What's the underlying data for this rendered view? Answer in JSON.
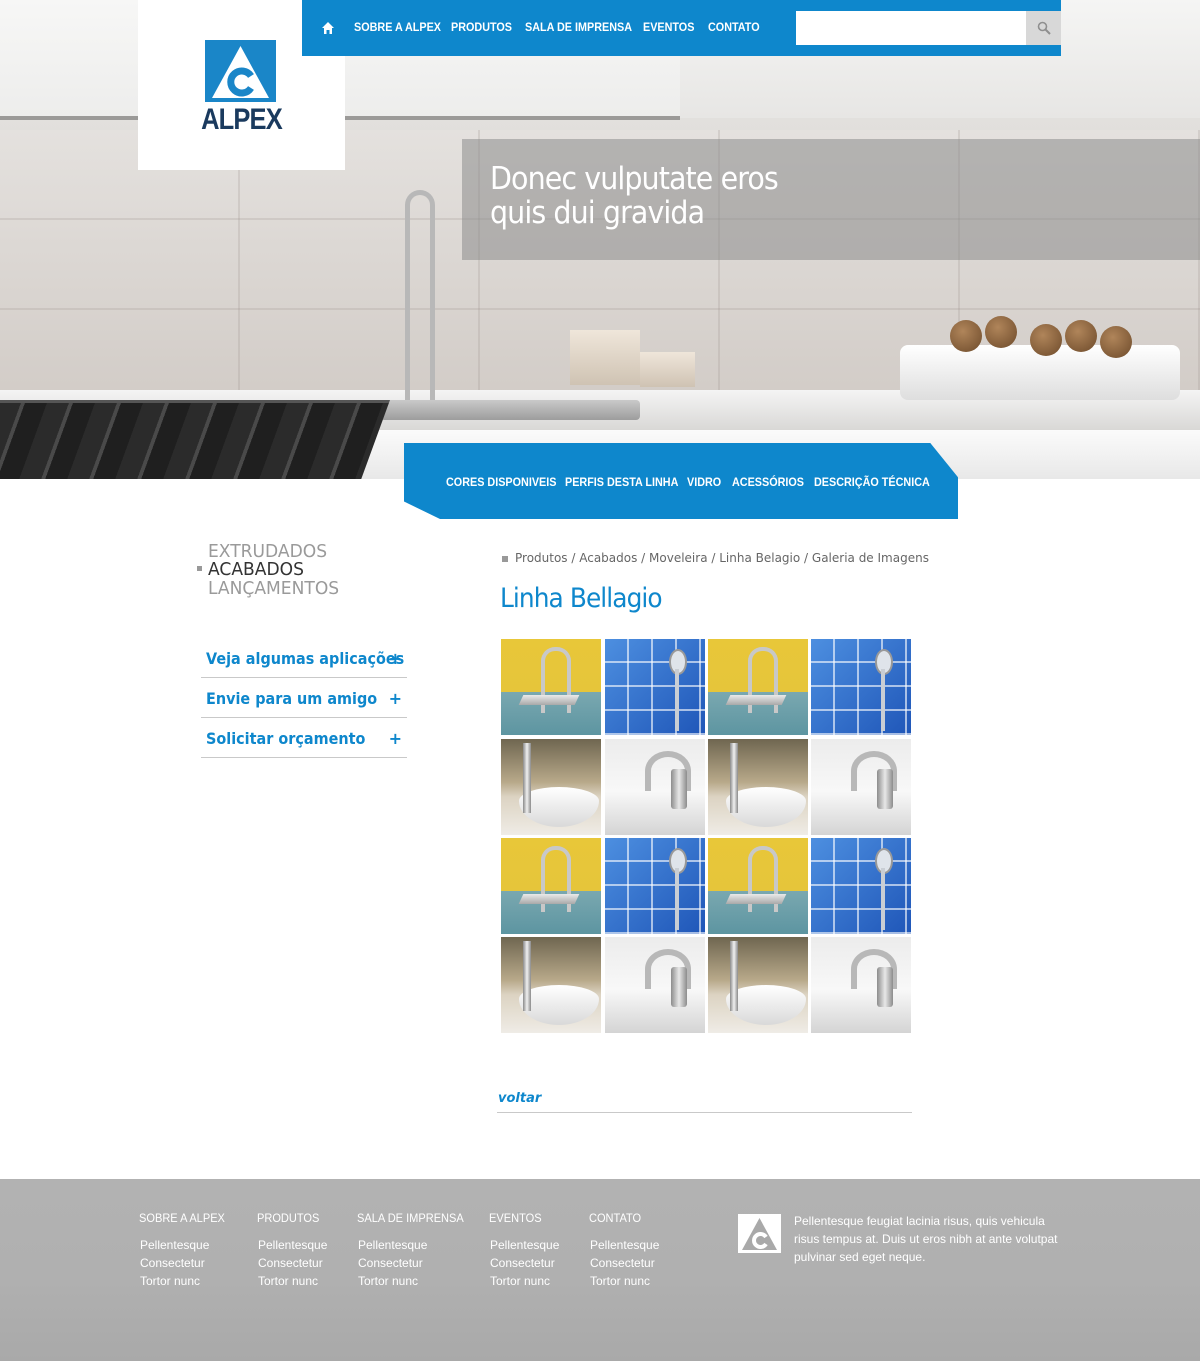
{
  "brand": {
    "name": "ALPEX",
    "accent_color": "#0e87cc",
    "logo_color": "#1a86c8"
  },
  "topnav": {
    "home_icon": "home-icon",
    "items": [
      "SOBRE A ALPEX",
      "PRODUTOS",
      "SALA DE IMPRENSA",
      "EVENTOS",
      "CONTATO"
    ],
    "search": {
      "placeholder": "",
      "value": "",
      "icon": "search-icon"
    }
  },
  "hero": {
    "caption_line1": "Donec vulputate eros",
    "caption_line2": "quis dui gravida"
  },
  "subnav": {
    "items": [
      "CORES DISPONIVEIS",
      "PERFIS DESTA LINHA",
      "VIDRO",
      "ACESSÓRIOS",
      "DESCRIÇÃO TÉCNICA"
    ]
  },
  "categories": {
    "items": [
      "EXTRUDADOS",
      "ACABADOS",
      "LANÇAMENTOS"
    ],
    "active": "ACABADOS"
  },
  "side_links": [
    {
      "label": "Veja algumas aplicações",
      "icon": "+"
    },
    {
      "label": "Envie para um amigo",
      "icon": "+"
    },
    {
      "label": "Solicitar orçamento",
      "icon": "+"
    }
  ],
  "breadcrumb": "Produtos / Acabados / Moveleira / Linha Belagio / Galeria de Imagens",
  "page_title": "Linha Bellagio",
  "gallery": {
    "rows": [
      [
        "shower-yellow",
        "shower-blue",
        "shower-yellow",
        "shower-blue"
      ],
      [
        "basin-faucet",
        "chrome-tap",
        "basin-faucet",
        "chrome-tap"
      ],
      [
        "shower-yellow",
        "shower-blue",
        "shower-yellow",
        "shower-blue"
      ],
      [
        "basin-faucet",
        "chrome-tap",
        "basin-faucet",
        "chrome-tap"
      ]
    ]
  },
  "back_link": "voltar",
  "footer": {
    "columns": [
      {
        "heading": "SOBRE A ALPEX",
        "items": [
          "Pellentesque",
          "Consectetur",
          "Tortor nunc"
        ]
      },
      {
        "heading": "PRODUTOS",
        "items": [
          "Pellentesque",
          "Consectetur",
          "Tortor nunc"
        ]
      },
      {
        "heading": "SALA DE IMPRENSA",
        "items": [
          "Pellentesque",
          "Consectetur",
          "Tortor nunc"
        ]
      },
      {
        "heading": "EVENTOS",
        "items": [
          "Pellentesque",
          "Consectetur",
          "Tortor nunc"
        ]
      },
      {
        "heading": "CONTATO",
        "items": [
          "Pellentesque",
          "Consectetur",
          "Tortor nunc"
        ]
      }
    ],
    "about_text": "Pellentesque feugiat lacinia risus, quis vehicula risus tempus at. Duis ut eros nibh at ante volutpat pulvinar sed eget neque."
  }
}
